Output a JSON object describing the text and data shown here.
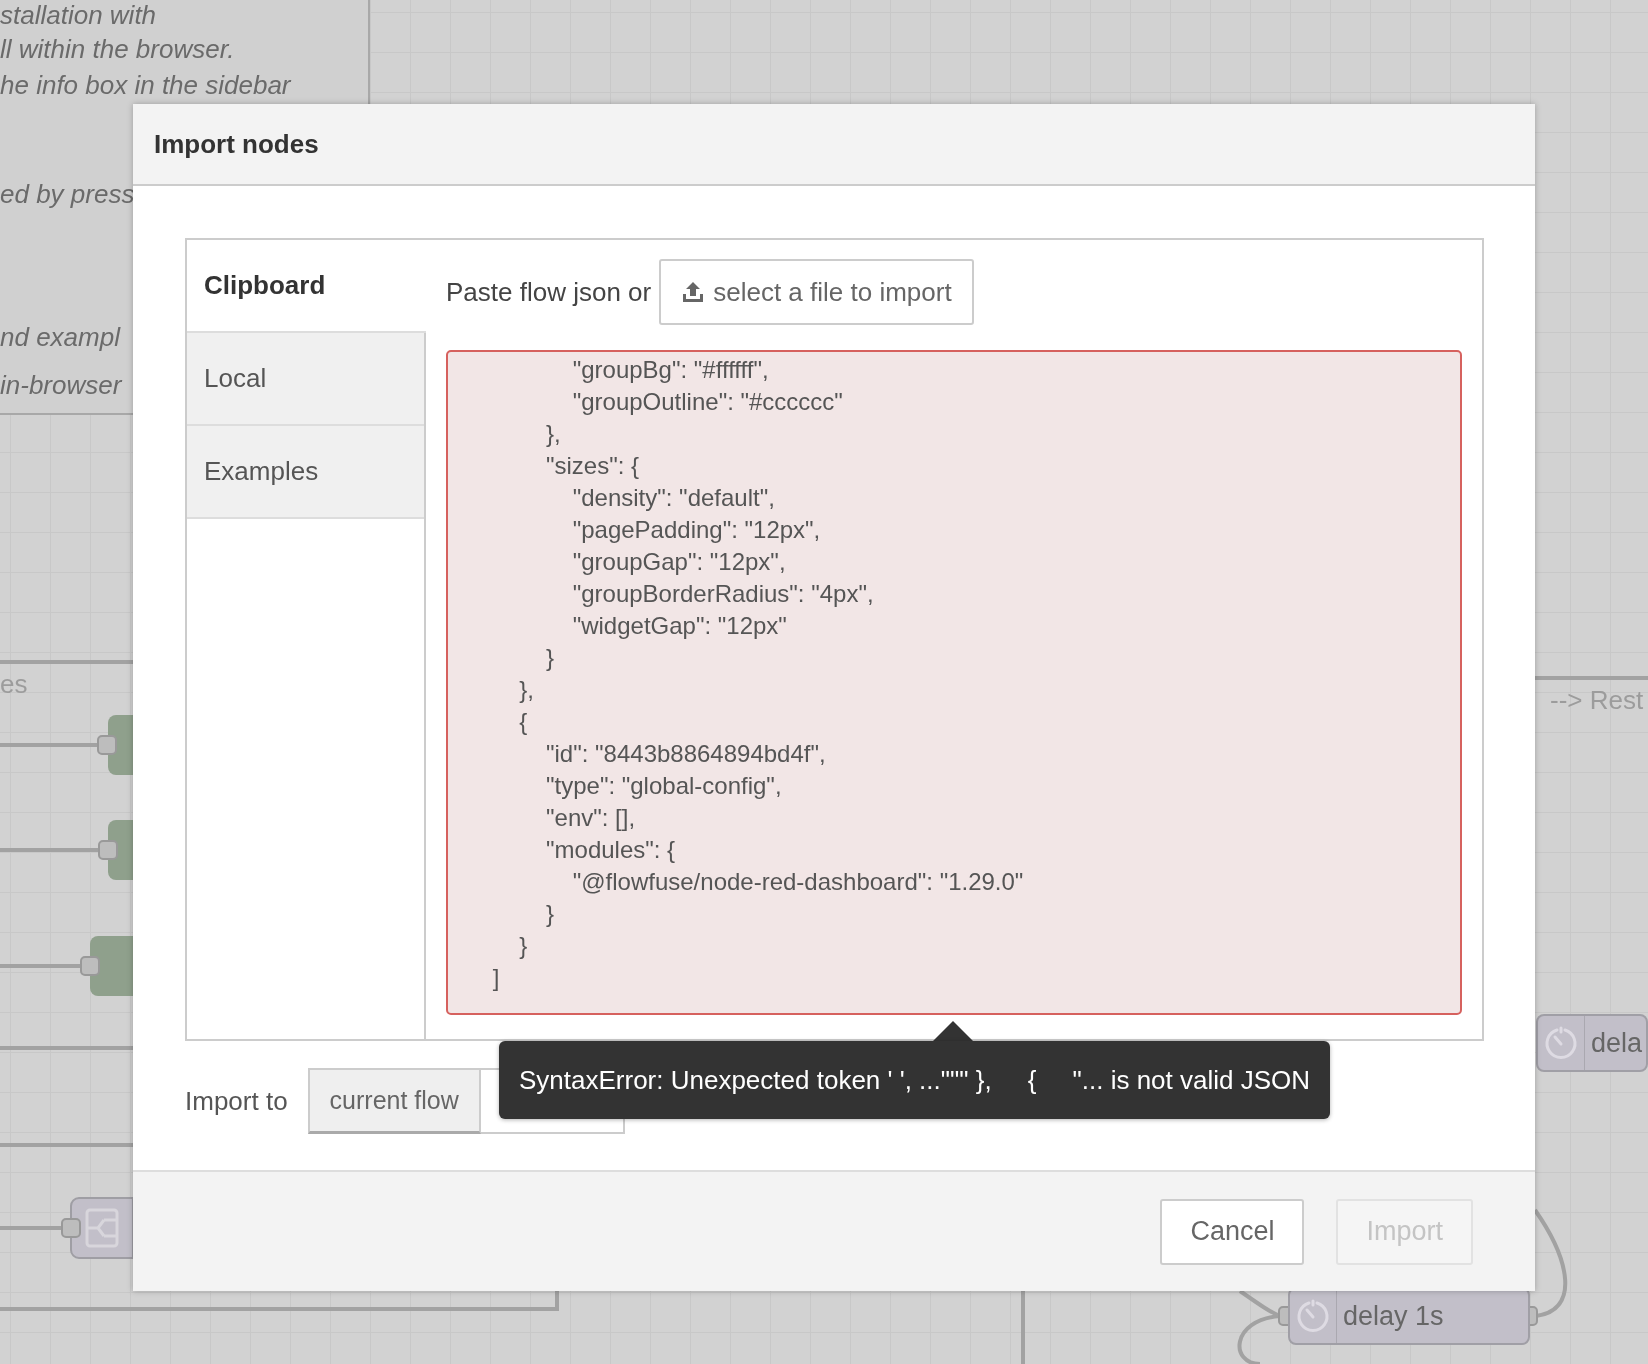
{
  "canvas": {
    "comment_lines": [
      "stallation with",
      "ll within the browser.",
      "he info box in the sidebar",
      "ed by press",
      "nd exampl",
      "in-browser"
    ],
    "wire_labels": [
      "es",
      "--> Rest"
    ],
    "nodes": [
      {
        "label": "dela"
      },
      {
        "label": "delay 1s"
      }
    ]
  },
  "dialog": {
    "title": "Import nodes",
    "tabs": [
      {
        "label": "Clipboard",
        "selected": true
      },
      {
        "label": "Local",
        "selected": false
      },
      {
        "label": "Examples",
        "selected": false
      }
    ],
    "paste_label": "Paste flow json or",
    "file_button": "select a file to import",
    "json_invalid": true,
    "json_text": "                \"groupBg\": \"#ffffff\",\n                \"groupOutline\": \"#cccccc\"\n            },\n            \"sizes\": {\n                \"density\": \"default\",\n                \"pagePadding\": \"12px\",\n                \"groupGap\": \"12px\",\n                \"groupBorderRadius\": \"4px\",\n                \"widgetGap\": \"12px\"\n            }\n        },\n        {\n            \"id\": \"8443b8864894bd4f\",\n            \"type\": \"global-config\",\n            \"env\": [],\n            \"modules\": {\n                \"@flowfuse/node-red-dashboard\": \"1.29.0\"\n            }\n        }\n    ]",
    "error_tooltip": "SyntaxError: Unexpected token ' ', ...\"\"\" },     {     \"... is not valid JSON",
    "import_to": {
      "label": "Import to",
      "options": [
        {
          "label": "current flow",
          "selected": true
        }
      ]
    },
    "buttons": [
      {
        "label": "Cancel",
        "disabled": false
      },
      {
        "label": "Import",
        "disabled": true
      }
    ]
  }
}
